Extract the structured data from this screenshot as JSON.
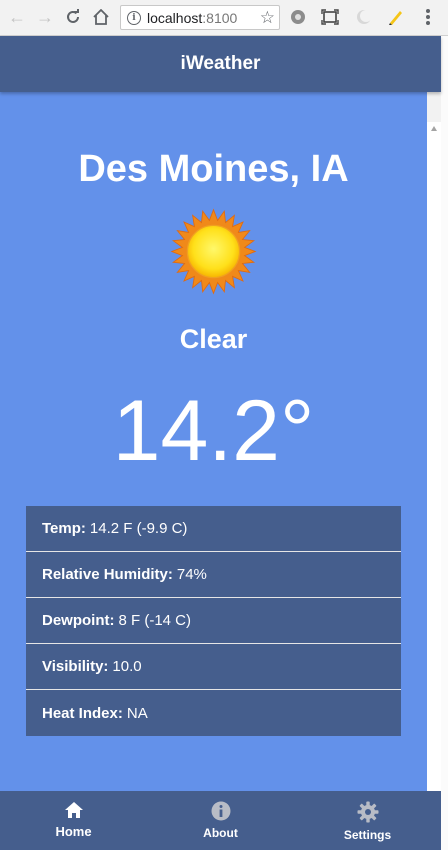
{
  "browser": {
    "url_host": "localhost",
    "url_port": ":8100"
  },
  "app": {
    "title": "iWeather"
  },
  "weather": {
    "city": "Des Moines, IA",
    "condition": "Clear",
    "temperature_display": "14.2°",
    "details": [
      {
        "label": "Temp:",
        "value": "14.2 F (-9.9 C)"
      },
      {
        "label": "Relative Humidity:",
        "value": "74%"
      },
      {
        "label": "Dewpoint:",
        "value": "8 F (-14 C)"
      },
      {
        "label": "Visibility:",
        "value": "10.0"
      },
      {
        "label": "Heat Index:",
        "value": "NA"
      }
    ]
  },
  "tabs": [
    {
      "label": "Home",
      "icon": "home-icon",
      "active": true
    },
    {
      "label": "About",
      "icon": "info-icon",
      "active": false
    },
    {
      "label": "Settings",
      "icon": "gear-icon",
      "active": false
    }
  ],
  "colors": {
    "header": "#455e8d",
    "background": "#6391ea",
    "text": "#ffffff"
  }
}
